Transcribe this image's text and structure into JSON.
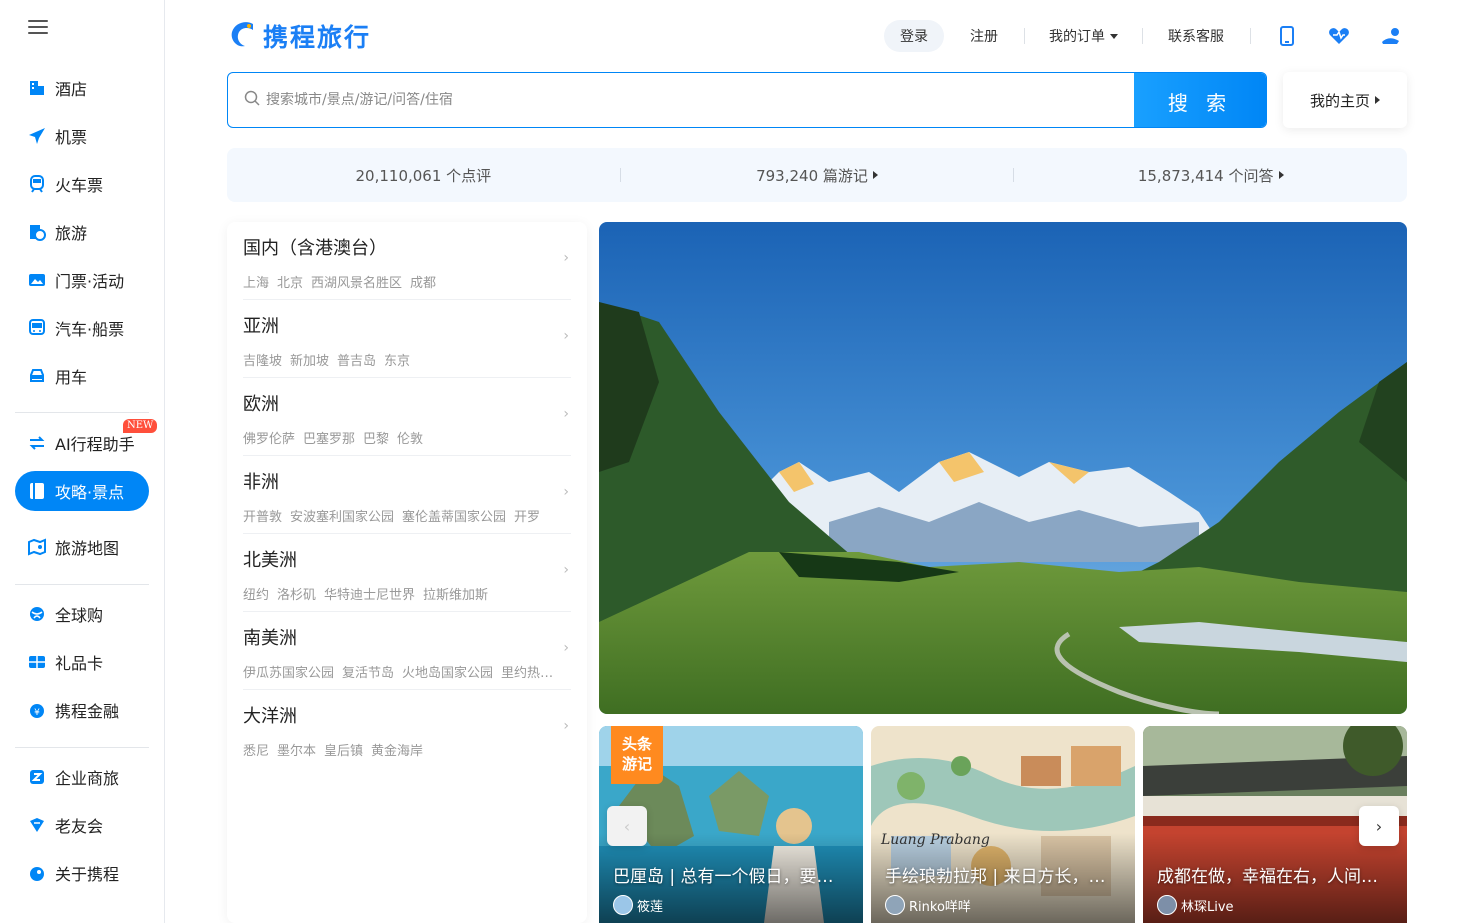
{
  "brand": {
    "logo_text": "携程旅行"
  },
  "sidebar": {
    "items": [
      {
        "label": "酒店",
        "icon": "hotel-icon"
      },
      {
        "label": "机票",
        "icon": "plane-icon"
      },
      {
        "label": "火车票",
        "icon": "train-icon"
      },
      {
        "label": "旅游",
        "icon": "travel-icon"
      },
      {
        "label": "门票·活动",
        "icon": "ticket-icon"
      },
      {
        "label": "汽车·船票",
        "icon": "bus-icon"
      },
      {
        "label": "用车",
        "icon": "car-icon"
      },
      {
        "label": "AI行程助手",
        "icon": "ai-assistant-icon",
        "badge": "NEW"
      },
      {
        "label": "攻略·景点",
        "icon": "guide-icon",
        "active": true
      },
      {
        "label": "旅游地图",
        "icon": "map-icon"
      },
      {
        "label": "全球购",
        "icon": "global-shop-icon"
      },
      {
        "label": "礼品卡",
        "icon": "gift-card-icon"
      },
      {
        "label": "携程金融",
        "icon": "finance-icon"
      },
      {
        "label": "企业商旅",
        "icon": "business-icon"
      },
      {
        "label": "老友会",
        "icon": "member-icon"
      },
      {
        "label": "关于携程",
        "icon": "about-icon"
      }
    ]
  },
  "header": {
    "login": "登录",
    "register": "注册",
    "my_orders": "我的订单",
    "customer_service": "联系客服",
    "icons": [
      "mobile-icon",
      "heart-icon",
      "support-icon"
    ]
  },
  "search": {
    "placeholder": "搜索城市/景点/游记/问答/住宿",
    "button": "搜 索",
    "my_home": "我的主页"
  },
  "stats": {
    "reviews": "20,110,061 个点评",
    "travelogues": "793,240 篇游记",
    "answers": "15,873,414 个问答"
  },
  "regions": [
    {
      "name": "国内（含港澳台）",
      "places": [
        "上海",
        "北京",
        "西湖风景名胜区",
        "成都"
      ]
    },
    {
      "name": "亚洲",
      "places": [
        "吉隆坡",
        "新加坡",
        "普吉岛",
        "东京"
      ]
    },
    {
      "name": "欧洲",
      "places": [
        "佛罗伦萨",
        "巴塞罗那",
        "巴黎",
        "伦敦"
      ]
    },
    {
      "name": "非洲",
      "places": [
        "开普敦",
        "安波塞利国家公园",
        "塞伦盖蒂国家公园",
        "开罗"
      ]
    },
    {
      "name": "北美洲",
      "places": [
        "纽约",
        "洛杉矶",
        "华特迪士尼世界",
        "拉斯维加斯"
      ]
    },
    {
      "name": "南美洲",
      "places": [
        "伊瓜苏国家公园",
        "复活节岛",
        "火地岛国家公园",
        "里约热内卢"
      ]
    },
    {
      "name": "大洋洲",
      "places": [
        "悉尼",
        "墨尔本",
        "皇后镇",
        "黄金海岸"
      ]
    }
  ],
  "cards": [
    {
      "title": "巴厘岛 | 总有一个假日，要留给巴厘岛",
      "author": "筱莲",
      "tag": "头条\n游记"
    },
    {
      "title": "手绘琅勃拉邦 | 来日方长，何惧车遥马慢",
      "author": "Rinko咩咩"
    },
    {
      "title": "成都在做，幸福在右，人间烟火气",
      "author": "林琛Live"
    }
  ],
  "colors": {
    "accent": "#0086f6",
    "tag": "#ff8a1f",
    "badge": "#ff4f3b"
  }
}
